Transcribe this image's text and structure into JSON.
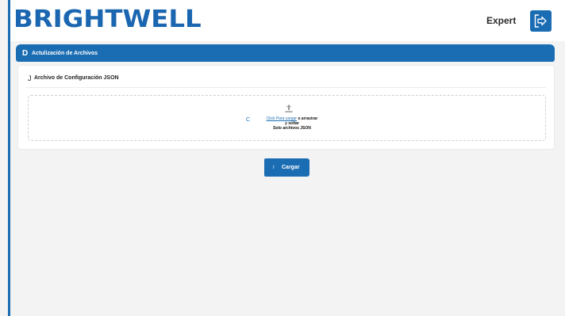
{
  "header": {
    "logo_text": "BRIGHTWELL",
    "user_label": "Expert",
    "logout_icon": "logout-arrow-icon"
  },
  "section": {
    "icon_glyph": "D",
    "title": "Actulización de Archivos"
  },
  "card": {
    "icon_glyph": "J",
    "title": "Archivo de Configuración JSON"
  },
  "dropzone": {
    "side_icon_glyph": "C",
    "upload_icon": "upload-tray-icon",
    "click_link": "Click Para cargar",
    "text_after_link": "o arrastrar",
    "text_line2": "y soltar",
    "hint": "Solo archivos JSON"
  },
  "upload_button": {
    "icon_glyph": "I",
    "label": "Cargar"
  },
  "colors": {
    "primary": "#1b6db3",
    "logo": "#1a66b0",
    "background": "#f3f3f3",
    "card": "#ffffff"
  }
}
